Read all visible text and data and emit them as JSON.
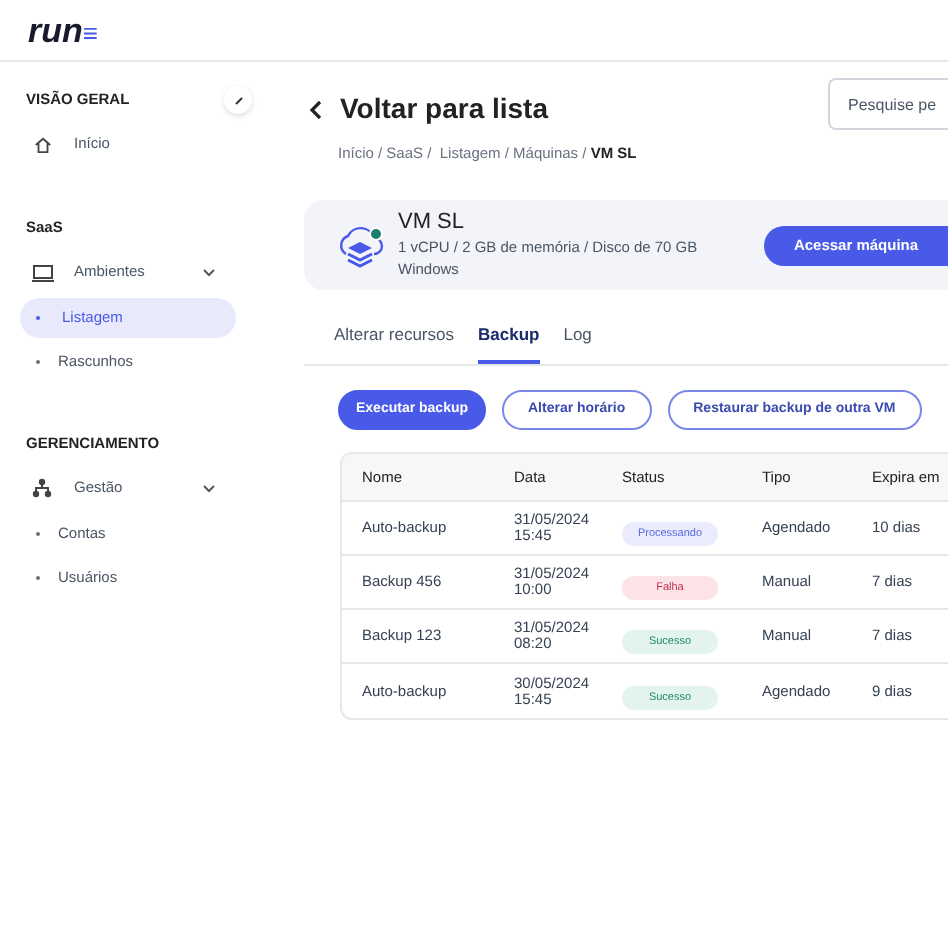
{
  "logo": {
    "text": "run",
    "mark": "≡"
  },
  "sidebar": {
    "sections": [
      {
        "title": "VISÃO GERAL",
        "items": [
          {
            "label": "Início",
            "selected": false
          }
        ]
      },
      {
        "title": "SaaS",
        "items": [
          {
            "label": "Ambientes",
            "expanded": true,
            "selected": false,
            "children": [
              {
                "label": "Listagem",
                "selected": true
              },
              {
                "label": "Rascunhos",
                "selected": false
              }
            ]
          }
        ]
      },
      {
        "title": "GERENCIAMENTO",
        "items": [
          {
            "label": "Gestão",
            "expanded": true,
            "selected": false,
            "children": [
              {
                "label": "Contas",
                "selected": false
              },
              {
                "label": "Usuários",
                "selected": false
              }
            ]
          }
        ]
      }
    ]
  },
  "header": {
    "back_label": "Voltar para lista",
    "breadcrumb": "Início / SaaS /  Listagem / Máquinas / **VM SL**",
    "search": {
      "placeholder": "Pesquise pe"
    }
  },
  "machine": {
    "name": "VM SL",
    "specs": "1 vCPU / 2 GB de memória / Disco de 70 GB",
    "os": "Windows",
    "online": true,
    "action": "Acessar máquina"
  },
  "tabs": [
    {
      "label": "Alterar recursos",
      "selected": false
    },
    {
      "label": "Backup",
      "selected": true
    },
    {
      "label": "Log",
      "selected": false
    }
  ],
  "actions": [
    {
      "label": "Executar backup",
      "kind": "primary"
    },
    {
      "label": "Alterar horário",
      "kind": "outline"
    },
    {
      "label": "Restaurar backup de outra VM",
      "kind": "outline"
    }
  ],
  "table": {
    "columns": [
      "Nome",
      "Data",
      "Status",
      "Tipo",
      "Expira em"
    ],
    "rows": [
      {
        "name": "Auto-backup",
        "date": "31/05/2024",
        "time": "15:45",
        "status": {
          "label": "Processando",
          "kind": "processing"
        },
        "type": "Agendado",
        "expires": "10 dias"
      },
      {
        "name": "Backup 456",
        "date": "31/05/2024",
        "time": "10:00",
        "status": {
          "label": "Falha",
          "kind": "failure"
        },
        "type": "Manual",
        "expires": "7 dias"
      },
      {
        "name": "Backup 123",
        "date": "31/05/2024",
        "time": "08:20",
        "status": {
          "label": "Sucesso",
          "kind": "success"
        },
        "type": "Manual",
        "expires": "7 dias"
      },
      {
        "name": "Auto-backup",
        "date": "30/05/2024",
        "time": "15:45",
        "status": {
          "label": "Sucesso",
          "kind": "success"
        },
        "type": "Agendado",
        "expires": "9 dias"
      }
    ]
  }
}
